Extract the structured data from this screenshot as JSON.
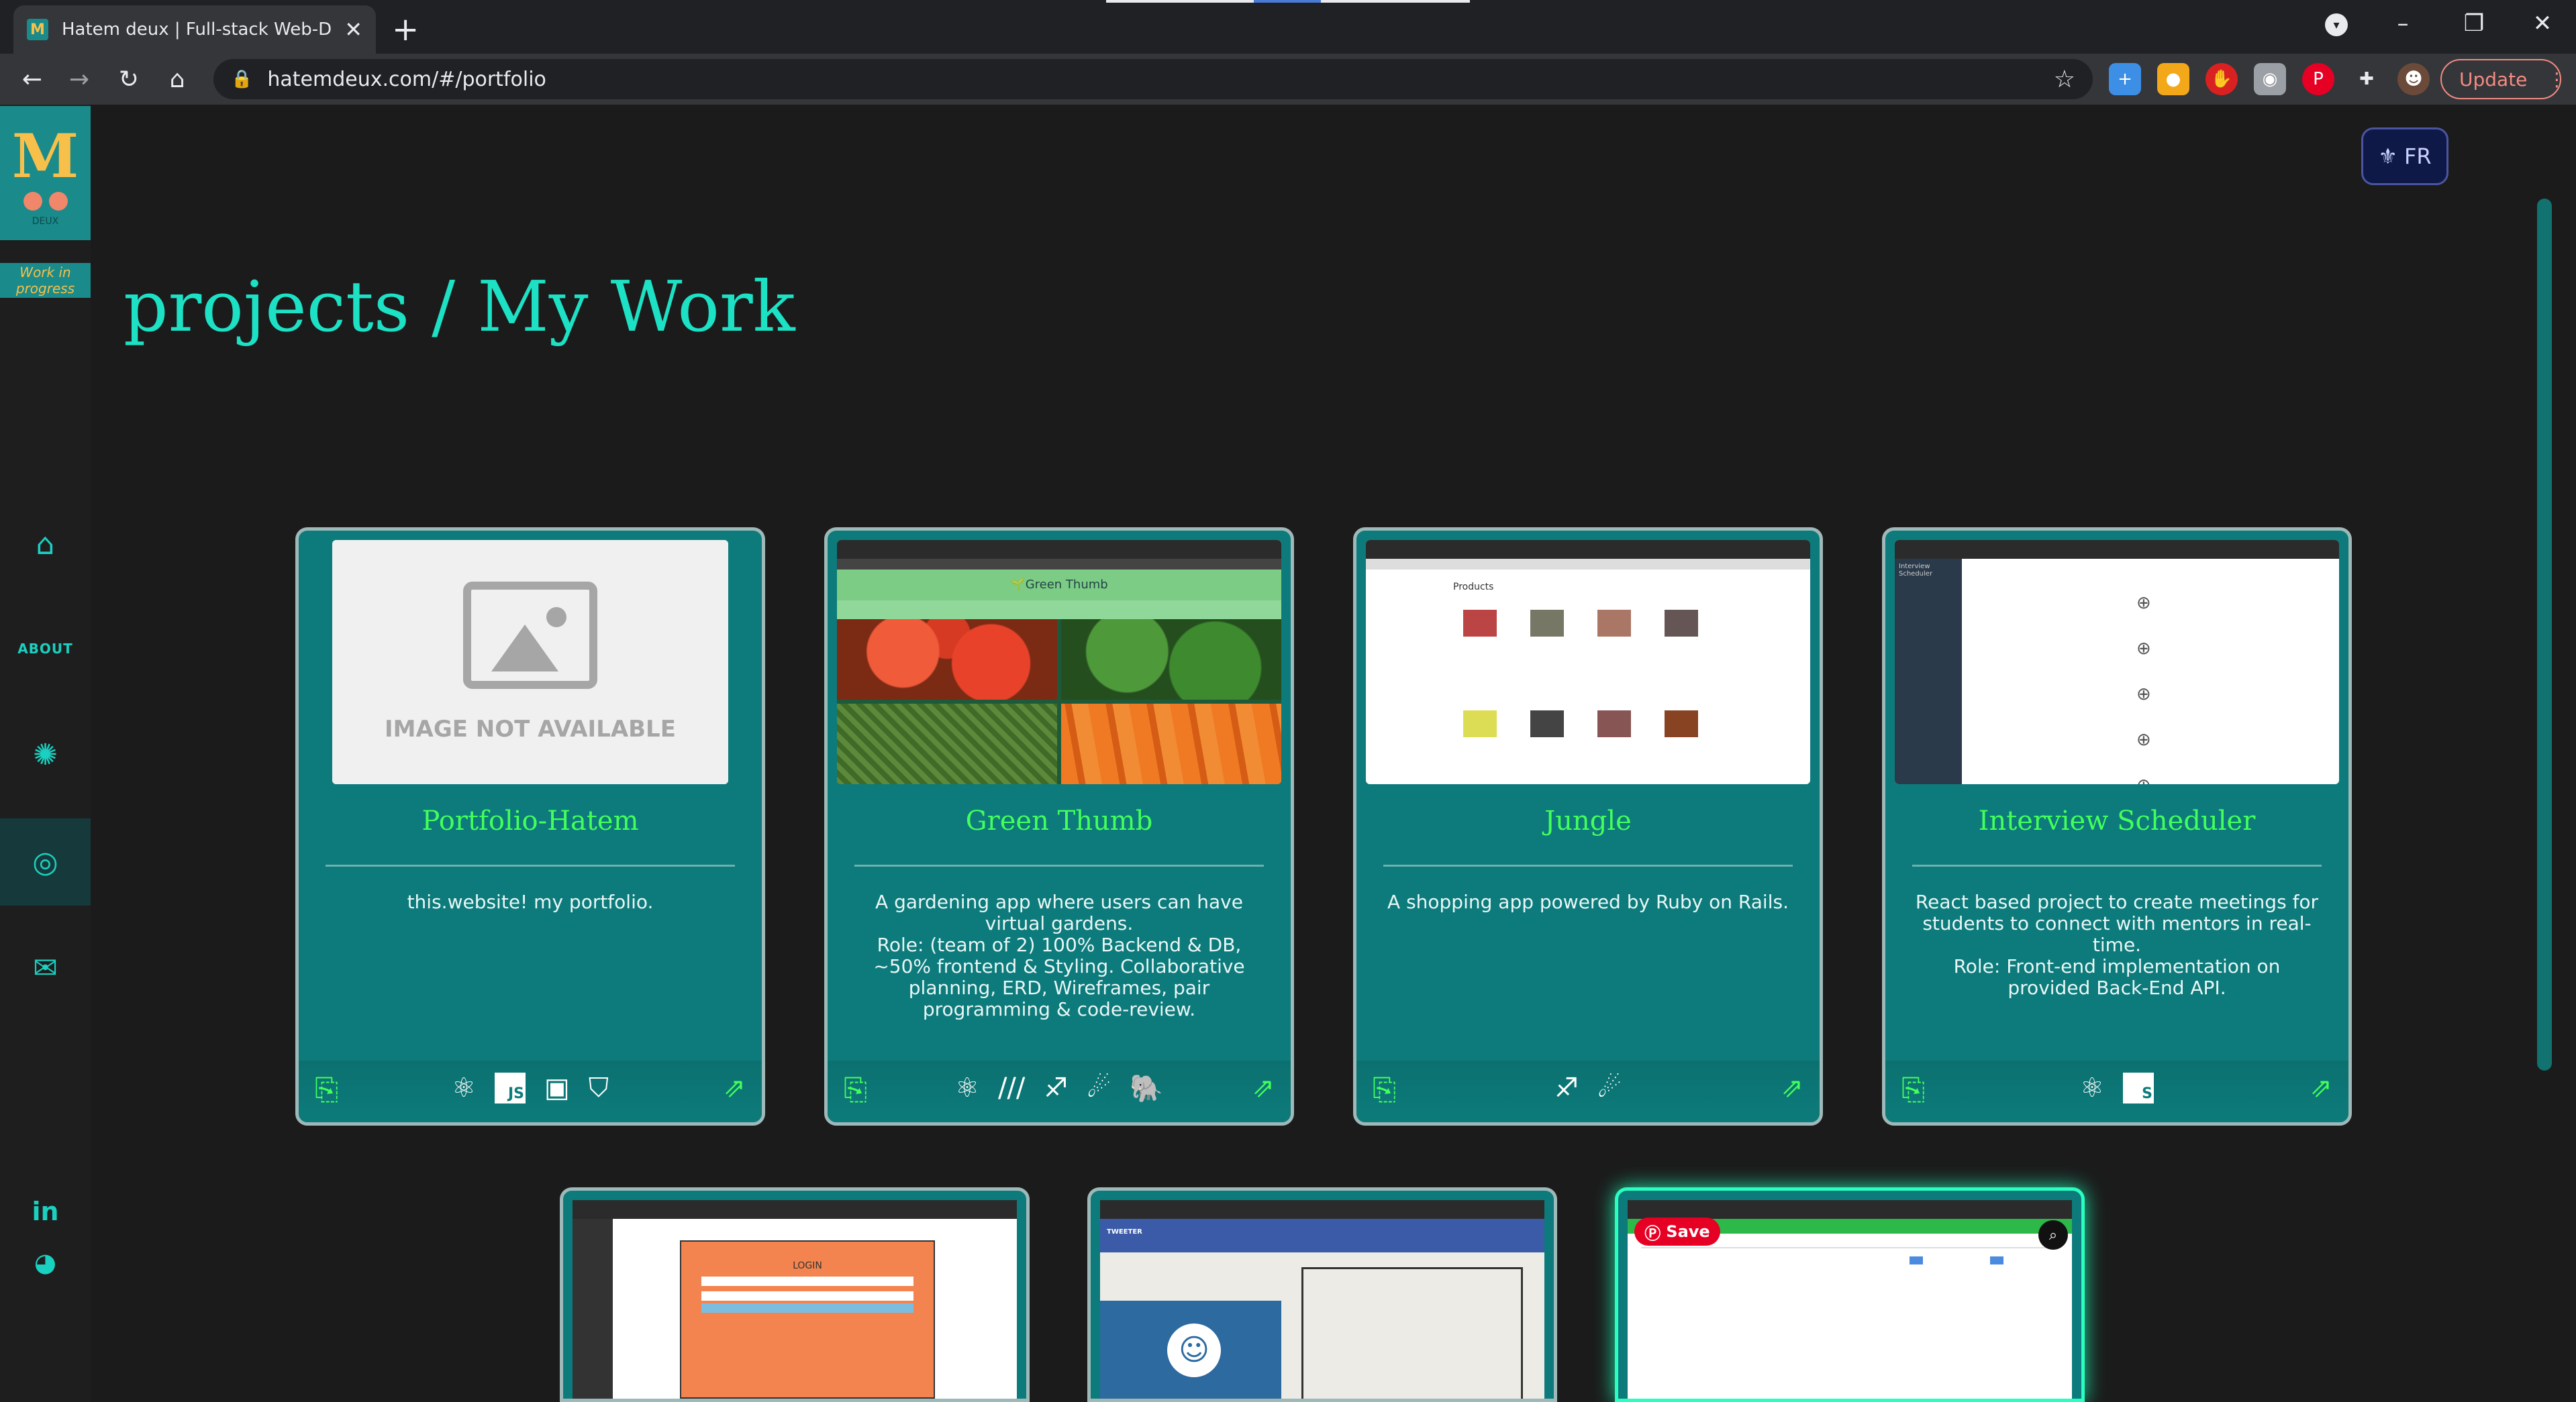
{
  "browser": {
    "tab_title": "Hatem deux | Full-stack Web-Dev",
    "tab_close": "✕",
    "new_tab": "+",
    "url": "hatemdeux.com/#/portfolio",
    "update_label": "Update"
  },
  "sidebar": {
    "logo_caption": "DEUX",
    "wip_label": "Work in progress",
    "about_label": "ABOUT"
  },
  "lang_button": {
    "label": "FR"
  },
  "page": {
    "title": "projects / My Work"
  },
  "projects": [
    {
      "title": "Portfolio-Hatem",
      "description": "this.website! my portfolio.",
      "image_placeholder": "IMAGE NOT AVAILABLE",
      "techs": [
        "react-icon",
        "js-icon",
        "css-icon",
        "css3-icon"
      ]
    },
    {
      "title": "Green Thumb",
      "description": "A gardening app where users can have virtual gardens.\nRole: (team of 2) 100% Backend & DB, ~50% frontend & Styling. Collaborative planning, ERD, Wireframes, pair programming & code-review.",
      "thumb_header": "🌱Green Thumb",
      "techs": [
        "react-icon",
        "sass-icon",
        "rails-icon",
        "rails-icon",
        "postgres-icon"
      ]
    },
    {
      "title": "Jungle",
      "description": "A shopping app powered by Ruby on Rails.",
      "thumb_header": "Products",
      "techs": [
        "rails-icon",
        "rails-icon"
      ]
    },
    {
      "title": "Interview Scheduler",
      "description": "React based project to create meetings for students to connect with mentors in real-time.\nRole: Front-end implementation on provided Back-End API.",
      "thumb_header": "Interview Scheduler",
      "techs": [
        "react-icon",
        "storybook-icon"
      ]
    }
  ],
  "bottom_projects": [
    {
      "thumb_header": "LOGIN"
    },
    {
      "thumb_header": "TWEETER"
    },
    {
      "save_label": "Save"
    }
  ]
}
